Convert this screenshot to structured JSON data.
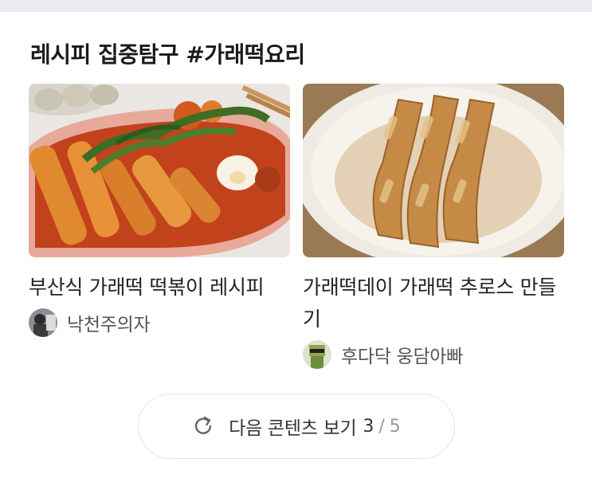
{
  "section": {
    "title": "레시피 집중탐구 #가래떡요리"
  },
  "items": [
    {
      "title": "부산식 가래떡 떡볶이 레시피",
      "author": "낙천주의자",
      "image": "tteokbokki-photo"
    },
    {
      "title": "가래떡데이 가래떡 추로스 만들기",
      "author": "후다닥 웅담아빠",
      "image": "churros-photo"
    }
  ],
  "more_button": {
    "label": "다음 콘텐츠 보기",
    "current_page": "3",
    "separator": "/",
    "total_pages": "5",
    "icon": "refresh-icon"
  },
  "colors": {
    "top_band": "#e9ebef",
    "title": "#1a1a1a",
    "author": "#555555",
    "button_border": "#e2e4e8"
  }
}
